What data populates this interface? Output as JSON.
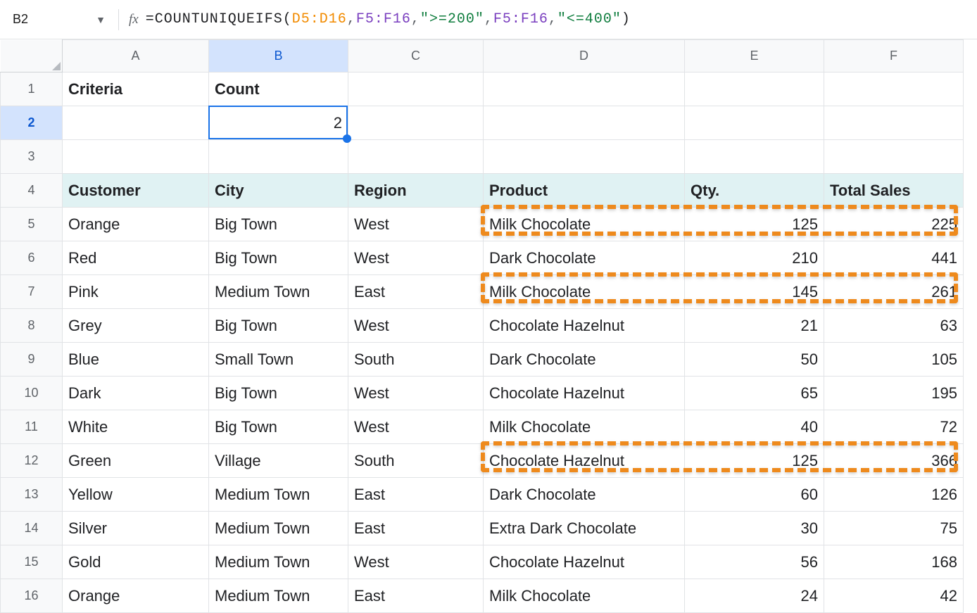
{
  "namebox": {
    "value": "B2"
  },
  "formula": {
    "fn": "COUNTUNIQUEIFS",
    "range1": "D5:D16",
    "range2a": "F5:F16",
    "crit1": "\">=200\"",
    "range2b": "F5:F16",
    "crit2": "\"<=400\""
  },
  "columns": [
    "A",
    "B",
    "C",
    "D",
    "E",
    "F"
  ],
  "row_numbers": [
    "1",
    "2",
    "3",
    "4",
    "5",
    "6",
    "7",
    "8",
    "9",
    "10",
    "11",
    "12",
    "13",
    "14",
    "15",
    "16"
  ],
  "r1": {
    "A": "Criteria",
    "B": "Count"
  },
  "r2": {
    "B": "2"
  },
  "r4": {
    "A": "Customer",
    "B": "City",
    "C": "Region",
    "D": "Product",
    "E": "Qty.",
    "F": "Total Sales"
  },
  "data": [
    {
      "customer": "Orange",
      "city": "Big Town",
      "region": "West",
      "product": "Milk Chocolate",
      "qty": "125",
      "total": "225"
    },
    {
      "customer": "Red",
      "city": "Big Town",
      "region": "West",
      "product": "Dark Chocolate",
      "qty": "210",
      "total": "441"
    },
    {
      "customer": "Pink",
      "city": "Medium Town",
      "region": "East",
      "product": "Milk Chocolate",
      "qty": "145",
      "total": "261"
    },
    {
      "customer": "Grey",
      "city": "Big Town",
      "region": "West",
      "product": "Chocolate Hazelnut",
      "qty": "21",
      "total": "63"
    },
    {
      "customer": "Blue",
      "city": "Small Town",
      "region": "South",
      "product": "Dark Chocolate",
      "qty": "50",
      "total": "105"
    },
    {
      "customer": "Dark",
      "city": "Big Town",
      "region": "West",
      "product": "Chocolate Hazelnut",
      "qty": "65",
      "total": "195"
    },
    {
      "customer": "White",
      "city": "Big Town",
      "region": "West",
      "product": "Milk Chocolate",
      "qty": "40",
      "total": "72"
    },
    {
      "customer": "Green",
      "city": "Village",
      "region": "South",
      "product": "Chocolate Hazelnut",
      "qty": "125",
      "total": "366"
    },
    {
      "customer": "Yellow",
      "city": "Medium Town",
      "region": "East",
      "product": "Dark Chocolate",
      "qty": "60",
      "total": "126"
    },
    {
      "customer": "Silver",
      "city": "Medium Town",
      "region": "East",
      "product": "Extra Dark Chocolate",
      "qty": "30",
      "total": "75"
    },
    {
      "customer": "Gold",
      "city": "Medium Town",
      "region": "West",
      "product": "Chocolate Hazelnut",
      "qty": "56",
      "total": "168"
    },
    {
      "customer": "Orange",
      "city": "Medium Town",
      "region": "East",
      "product": "Milk Chocolate",
      "qty": "24",
      "total": "42"
    }
  ],
  "highlighted_data_rows": [
    0,
    2,
    7
  ],
  "chart_data": {
    "type": "table",
    "title": "Unique products where Total Sales between 200 and 400",
    "formula": "=COUNTUNIQUEIFS(D5:D16,F5:F16,\">=200\",F5:F16,\"<=400\")",
    "result": 2,
    "columns": [
      "Customer",
      "City",
      "Region",
      "Product",
      "Qty.",
      "Total Sales"
    ],
    "rows": [
      [
        "Orange",
        "Big Town",
        "West",
        "Milk Chocolate",
        125,
        225
      ],
      [
        "Red",
        "Big Town",
        "West",
        "Dark Chocolate",
        210,
        441
      ],
      [
        "Pink",
        "Medium Town",
        "East",
        "Milk Chocolate",
        145,
        261
      ],
      [
        "Grey",
        "Big Town",
        "West",
        "Chocolate Hazelnut",
        21,
        63
      ],
      [
        "Blue",
        "Small Town",
        "South",
        "Dark Chocolate",
        50,
        105
      ],
      [
        "Dark",
        "Big Town",
        "West",
        "Chocolate Hazelnut",
        65,
        195
      ],
      [
        "White",
        "Big Town",
        "West",
        "Milk Chocolate",
        40,
        72
      ],
      [
        "Green",
        "Village",
        "South",
        "Chocolate Hazelnut",
        125,
        366
      ],
      [
        "Yellow",
        "Medium Town",
        "East",
        "Dark Chocolate",
        60,
        126
      ],
      [
        "Silver",
        "Medium Town",
        "East",
        "Extra Dark Chocolate",
        30,
        75
      ],
      [
        "Gold",
        "Medium Town",
        "West",
        "Chocolate Hazelnut",
        56,
        168
      ],
      [
        "Orange",
        "Medium Town",
        "East",
        "Milk Chocolate",
        24,
        42
      ]
    ]
  }
}
